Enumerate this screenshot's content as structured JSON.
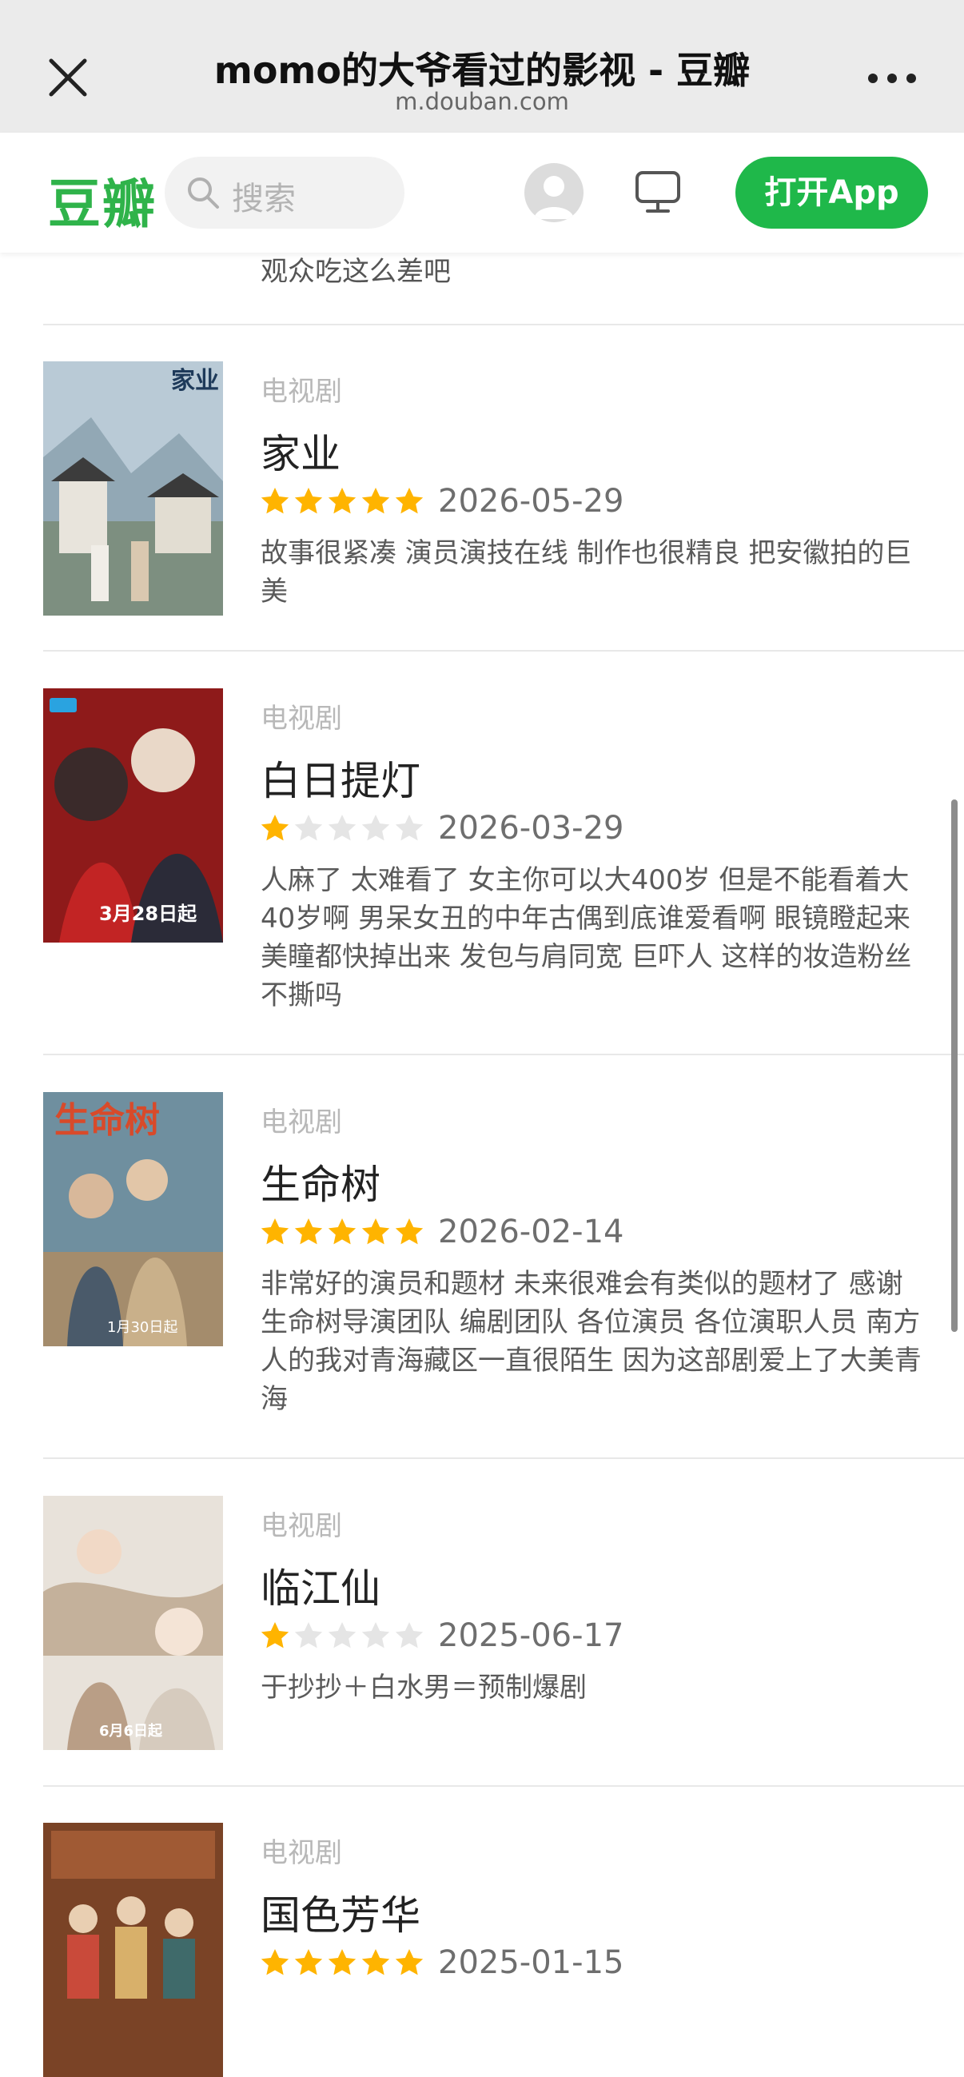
{
  "browser": {
    "title": "momo的大爷看过的影视 - 豆瓣",
    "url": "m.douban.com"
  },
  "nav": {
    "logo": "豆瓣",
    "search_placeholder": "搜索",
    "open_app_label": "打开App"
  },
  "partial_review": "观众吃这么差吧",
  "items": [
    {
      "category": "电视剧",
      "title": "家业",
      "rating": 5,
      "date": "2026-05-29",
      "review": "故事很紧凑 演员演技在线 制作也很精良 把安徽拍的巨美",
      "poster_text": "家业",
      "poster_color": "#8aa6b8"
    },
    {
      "category": "电视剧",
      "title": "白日提灯",
      "rating": 1,
      "date": "2026-03-29",
      "review": "人麻了 太难看了 女主你可以大400岁 但是不能看着大40岁啊 男呆女丑的中年古偶到底谁爱看啊 眼镜瞪起来美瞳都快掉出来 发包与肩同宽 巨吓人 这样的妆造粉丝不撕吗",
      "poster_text": "3月28日起",
      "poster_color": "#a32020"
    },
    {
      "category": "电视剧",
      "title": "生命树",
      "rating": 5,
      "date": "2026-02-14",
      "review": "非常好的演员和题材 未来很难会有类似的题材了 感谢生命树导演团队 编剧团队  各位演员 各位演职人员 南方人的我对青海藏区一直很陌生 因为这部剧爱上了大美青海",
      "poster_text": "生命树",
      "poster_color": "#5d7a8a"
    },
    {
      "category": "电视剧",
      "title": "临江仙",
      "rating": 1,
      "date": "2025-06-17",
      "review": "于抄抄＋白水男＝预制爆剧",
      "poster_text": "6月6日起",
      "poster_color": "#c9b7a6"
    },
    {
      "category": "电视剧",
      "title": "国色芳华",
      "rating": 5,
      "date": "2025-01-15",
      "review": "",
      "poster_text": "",
      "poster_color": "#8a4b2a"
    }
  ],
  "colors": {
    "brand": "#2fb34a",
    "star_on": "#ffb400",
    "star_off": "#e5e5e5"
  }
}
